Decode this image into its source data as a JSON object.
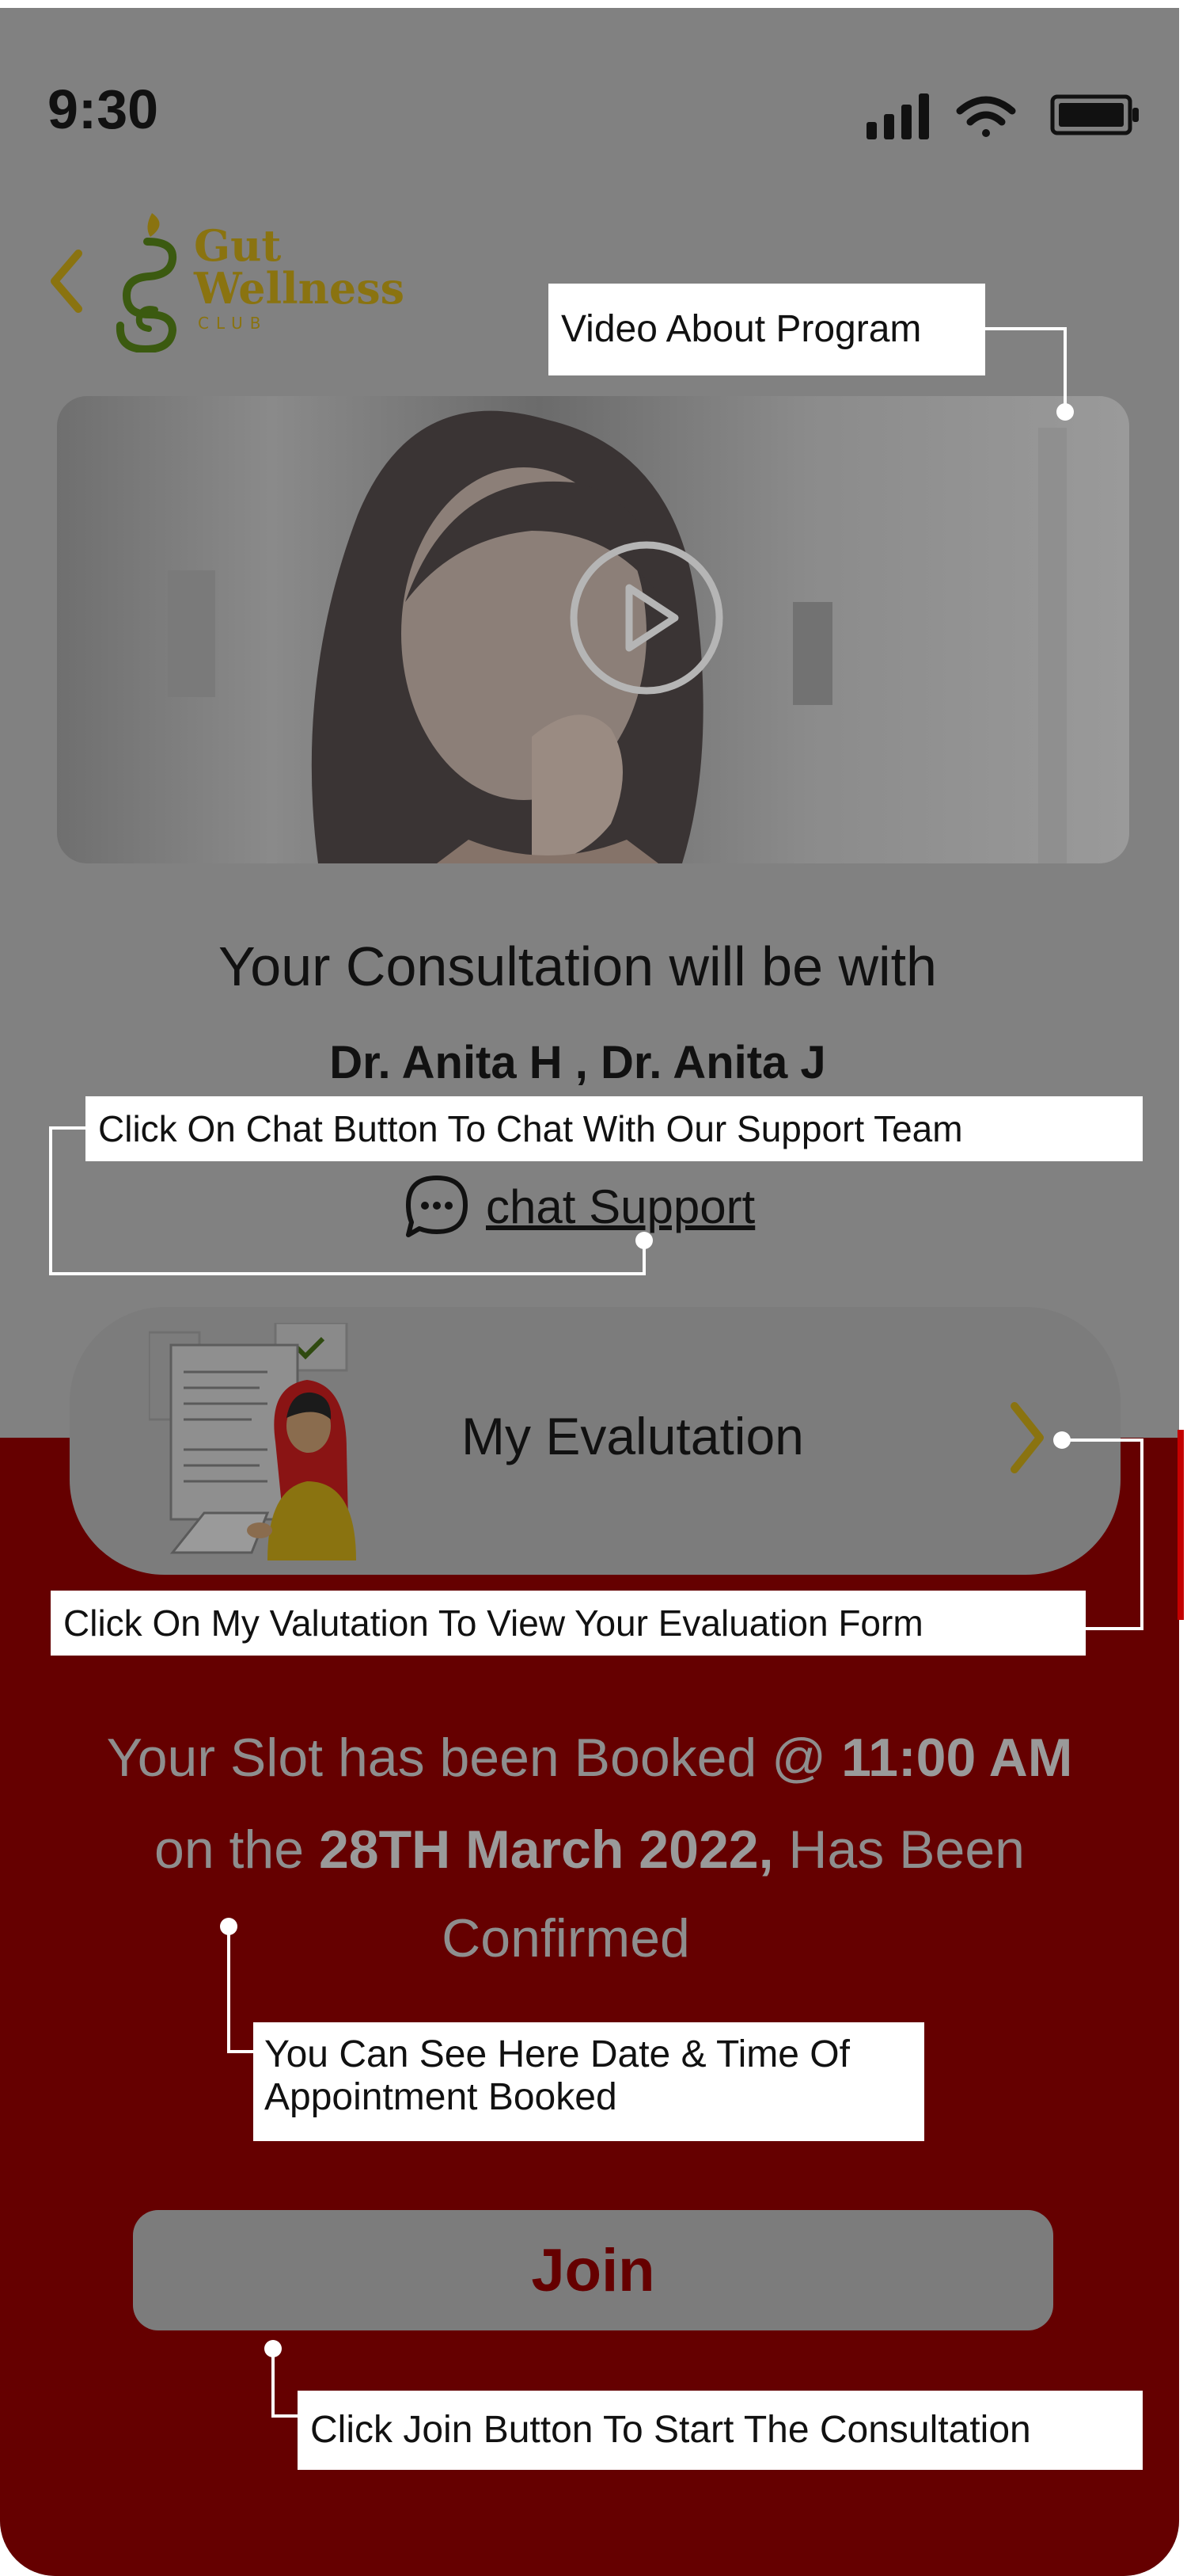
{
  "status_bar": {
    "time": "9:30"
  },
  "header": {
    "back_icon": "chevron-left-icon",
    "logo_words": [
      "Gut",
      "Wellness",
      "CLUB"
    ]
  },
  "video": {
    "play_icon": "play-icon"
  },
  "consultation": {
    "title": "Your Consultation will be with",
    "doctors": "Dr. Anita H , Dr. Anita J",
    "chat_label": "chat Support"
  },
  "evaluation": {
    "label": "My Evalutation"
  },
  "slot": {
    "line1_pre": "Your Slot has been Booked @ ",
    "time": "11:00 AM",
    "line2_pre": "on the ",
    "date": "28TH  March 2022,",
    "line2_post": " Has Been",
    "line3": "Confirmed"
  },
  "join": {
    "label": "Join"
  },
  "annotations": {
    "video": "Video About Program",
    "chat": "Click On Chat Button To Chat With Our Support Team",
    "evaluation": "Click On My Valutation To View Your Evaluation Form",
    "datetime": "You Can See Here Date & Time Of Appointment Booked",
    "join": "Click Join Button To Start The Consultation"
  },
  "colors": {
    "overlay_gray": "#818181",
    "bottom_red": "#650000",
    "brand_gold": "#8a7310",
    "brand_green": "#3b5a10",
    "callout_bg": "#ffffff"
  }
}
